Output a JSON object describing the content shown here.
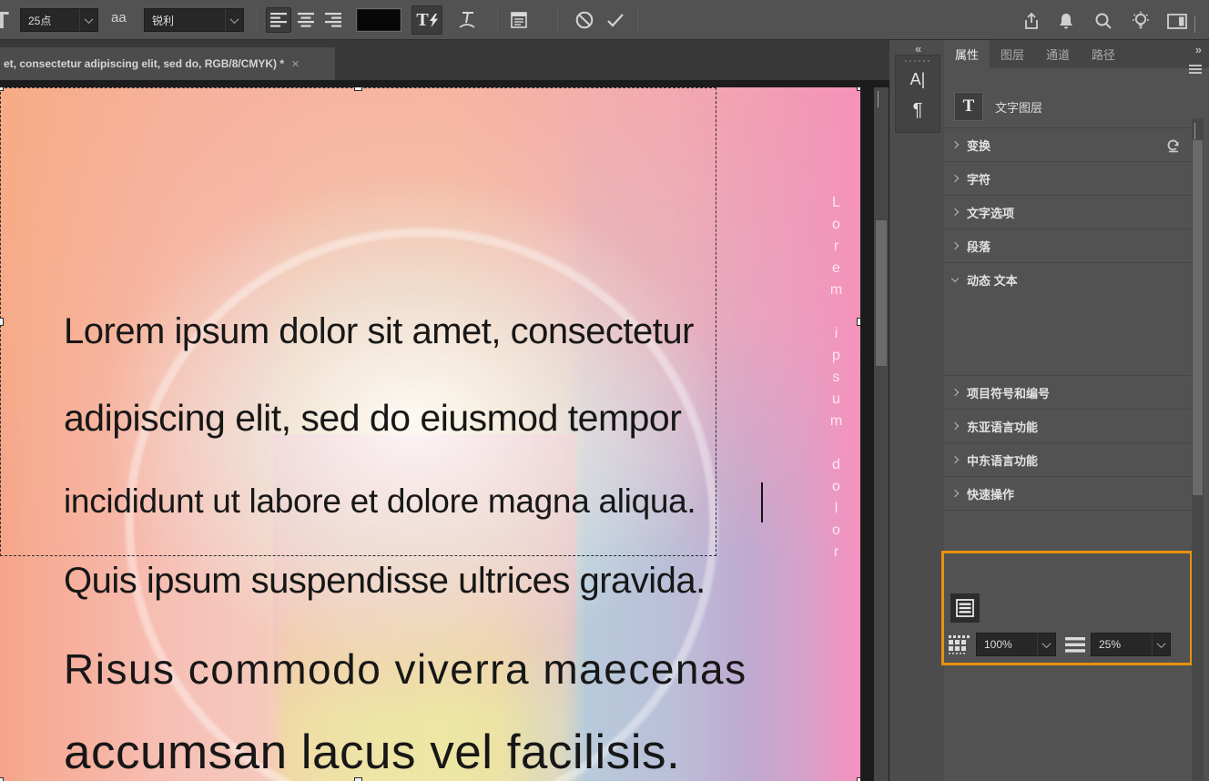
{
  "colors": {
    "highlight_orange": "#E8920D",
    "toolbar_bg": "#525252",
    "document_area_bg": "#1C1C1C",
    "text_color_swatch": "#070707"
  },
  "options_bar": {
    "size_tool_glyph": "T",
    "font_size_value": "25点",
    "anti_alias_glyph": "aa",
    "anti_alias_value": "锐利",
    "dynamic_text_glyph": "T"
  },
  "tab_bar": {
    "document_title": "et, consectetur adipiscing elit, sed do, RGB/8/CMYK) *",
    "close_glyph": "×"
  },
  "panel_strip": {
    "collapse_left_glyph": "«",
    "character_panel_glyph": "A|",
    "paragraph_panel_glyph": "¶"
  },
  "properties_panel": {
    "collapse_right_glyph": "»",
    "tabs": [
      {
        "label": "属性"
      },
      {
        "label": "图层"
      },
      {
        "label": "通道"
      },
      {
        "label": "路径"
      }
    ],
    "layer_badge_glyph": "T",
    "layer_type_label": "文字图层",
    "sections": {
      "transform": {
        "label": "变换"
      },
      "character": {
        "label": "字符"
      },
      "type_options": {
        "label": "文字选项"
      },
      "paragraph": {
        "label": "段落"
      },
      "dynamic_text": {
        "label": "动态 文本",
        "fill_value": "100%",
        "leading_value": "25%"
      },
      "bullets": {
        "label": "项目符号和编号"
      },
      "east_asian": {
        "label": "东亚语言功能"
      },
      "middle_east": {
        "label": "中东语言功能"
      },
      "quick_actions": {
        "label": "快速操作"
      }
    }
  },
  "canvas": {
    "vertical_text": "Lorem ipsum dolor",
    "text_lines": [
      "Lorem ipsum dolor sit amet, consectetur",
      "adipiscing elit, sed do eiusmod tempor",
      "incididunt ut labore et dolore magna aliqua.",
      "Quis ipsum suspendisse ultrices gravida.",
      "Risus commodo viverra maecenas",
      "accumsan lacus vel facilisis."
    ]
  }
}
